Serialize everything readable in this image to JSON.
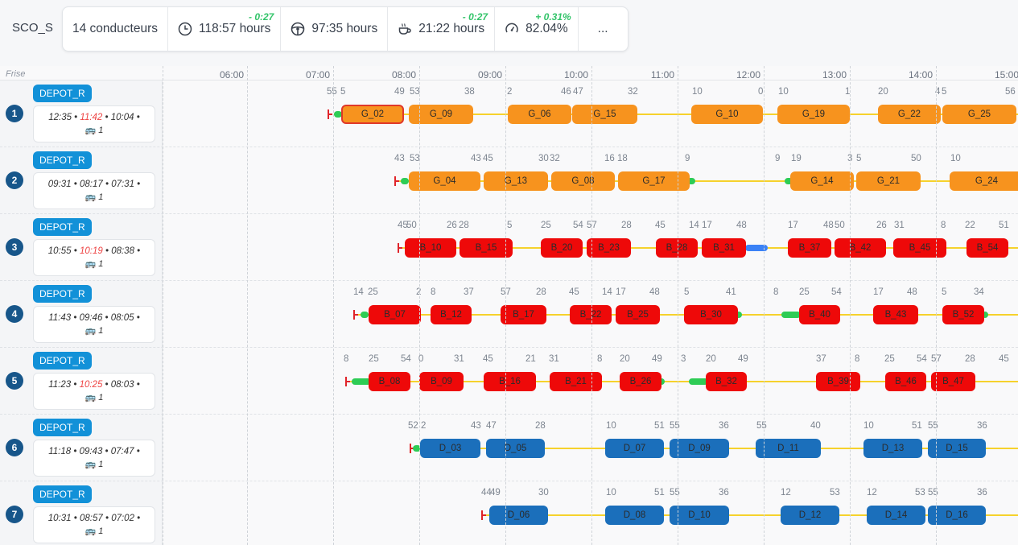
{
  "scenario": "SCO_S",
  "stats": {
    "drivers": "14 conducteurs",
    "total": "118:57 hours",
    "total_delta": "- 0:27",
    "driving": "97:35 hours",
    "pause": "21:22 hours",
    "pause_delta": "- 0:27",
    "ratio": "82.04%",
    "ratio_delta": "+ 0.31%",
    "more": "..."
  },
  "frise_label": "Frise",
  "hours": [
    "06:00",
    "07:00",
    "08:00",
    "09:00",
    "10:00",
    "11:00",
    "12:00",
    "13:00",
    "14:00",
    "15:00"
  ],
  "rows": [
    {
      "num": "1",
      "depot": "DEPOT_R",
      "t1": "12:35",
      "t2": "11:42",
      "t2_late": true,
      "t3": "10:04",
      "buses": "1",
      "marks": [
        "55",
        "5",
        "49",
        "53",
        "38",
        "2",
        "46",
        "47",
        "32",
        "10",
        "0",
        "10",
        "1",
        "20",
        "4",
        "5",
        "56"
      ],
      "blocks": [
        {
          "label": "G_02",
          "color": "orange",
          "selected": true
        },
        {
          "label": "G_09",
          "color": "orange"
        },
        {
          "label": "G_06",
          "color": "orange"
        },
        {
          "label": "G_15",
          "color": "orange"
        },
        {
          "label": "G_10",
          "color": "orange"
        },
        {
          "label": "G_19",
          "color": "orange"
        },
        {
          "label": "G_22",
          "color": "orange"
        },
        {
          "label": "G_25",
          "color": "orange"
        }
      ]
    },
    {
      "num": "2",
      "depot": "DEPOT_R",
      "t1": "09:31",
      "t2": "08:17",
      "t2_late": false,
      "t3": "07:31",
      "buses": "1",
      "marks": [
        "43",
        "53",
        "43",
        "45",
        "30",
        "32",
        "16",
        "18",
        "9",
        "9",
        "19",
        "3",
        "5",
        "50",
        "10"
      ],
      "blocks": [
        {
          "label": "G_04",
          "color": "orange"
        },
        {
          "label": "G_13",
          "color": "orange"
        },
        {
          "label": "G_08",
          "color": "orange"
        },
        {
          "label": "G_17",
          "color": "orange"
        },
        {
          "label": "G_14",
          "color": "orange"
        },
        {
          "label": "G_21",
          "color": "orange"
        },
        {
          "label": "G_24",
          "color": "orange"
        }
      ]
    },
    {
      "num": "3",
      "depot": "DEPOT_R",
      "t1": "10:55",
      "t2": "10:19",
      "t2_late": true,
      "t3": "08:38",
      "buses": "1",
      "marks": [
        "45",
        "50",
        "26",
        "28",
        "5",
        "25",
        "54",
        "57",
        "28",
        "45",
        "14",
        "17",
        "48",
        "17",
        "48",
        "50",
        "26",
        "31",
        "8",
        "22",
        "51"
      ],
      "blocks": [
        {
          "label": "B_10",
          "color": "red"
        },
        {
          "label": "B_15",
          "color": "red"
        },
        {
          "label": "B_20",
          "color": "red"
        },
        {
          "label": "B_23",
          "color": "red"
        },
        {
          "label": "B_28",
          "color": "red"
        },
        {
          "label": "B_31",
          "color": "red"
        },
        {
          "label": "B_37",
          "color": "red"
        },
        {
          "label": "B_42",
          "color": "red"
        },
        {
          "label": "B_45",
          "color": "red"
        },
        {
          "label": "B_54",
          "color": "red"
        }
      ]
    },
    {
      "num": "4",
      "depot": "DEPOT_R",
      "t1": "11:43",
      "t2": "09:46",
      "t2_late": false,
      "t3": "08:05",
      "buses": "1",
      "marks": [
        "14",
        "25",
        "2",
        "8",
        "37",
        "57",
        "28",
        "45",
        "14",
        "17",
        "48",
        "5",
        "41",
        "8",
        "25",
        "54",
        "17",
        "48",
        "5",
        "34"
      ],
      "blocks": [
        {
          "label": "B_07",
          "color": "red"
        },
        {
          "label": "B_12",
          "color": "red"
        },
        {
          "label": "B_17",
          "color": "red"
        },
        {
          "label": "B_22",
          "color": "red"
        },
        {
          "label": "B_25",
          "color": "red"
        },
        {
          "label": "B_30",
          "color": "red"
        },
        {
          "label": "B_40",
          "color": "red"
        },
        {
          "label": "B_43",
          "color": "red"
        },
        {
          "label": "B_52",
          "color": "red"
        }
      ]
    },
    {
      "num": "5",
      "depot": "DEPOT_R",
      "t1": "11:23",
      "t2": "10:25",
      "t2_late": true,
      "t3": "08:03",
      "buses": "1",
      "marks": [
        "8",
        "25",
        "54",
        "0",
        "31",
        "45",
        "21",
        "31",
        "8",
        "20",
        "49",
        "3",
        "20",
        "49",
        "37",
        "8",
        "25",
        "54",
        "57",
        "28",
        "45"
      ],
      "blocks": [
        {
          "label": "B_08",
          "color": "red"
        },
        {
          "label": "B_09",
          "color": "red"
        },
        {
          "label": "B_16",
          "color": "red"
        },
        {
          "label": "B_21",
          "color": "red"
        },
        {
          "label": "B_26",
          "color": "red"
        },
        {
          "label": "B_32",
          "color": "red"
        },
        {
          "label": "B_39",
          "color": "red"
        },
        {
          "label": "B_46",
          "color": "red"
        },
        {
          "label": "B_47",
          "color": "red"
        }
      ]
    },
    {
      "num": "6",
      "depot": "DEPOT_R",
      "t1": "11:18",
      "t2": "09:43",
      "t2_late": false,
      "t3": "07:47",
      "buses": "1",
      "marks": [
        "52",
        "2",
        "43",
        "47",
        "28",
        "10",
        "51",
        "55",
        "36",
        "55",
        "40",
        "10",
        "51",
        "55",
        "36"
      ],
      "blocks": [
        {
          "label": "D_03",
          "color": "blue"
        },
        {
          "label": "D_05",
          "color": "blue"
        },
        {
          "label": "D_07",
          "color": "blue"
        },
        {
          "label": "D_09",
          "color": "blue"
        },
        {
          "label": "D_11",
          "color": "blue"
        },
        {
          "label": "D_13",
          "color": "blue"
        },
        {
          "label": "D_15",
          "color": "blue"
        }
      ]
    },
    {
      "num": "7",
      "depot": "DEPOT_R",
      "t1": "10:31",
      "t2": "08:57",
      "t2_late": false,
      "t3": "07:02",
      "buses": "1",
      "marks": [
        "44",
        "49",
        "30",
        "10",
        "51",
        "55",
        "36",
        "12",
        "53",
        "12",
        "53",
        "55",
        "36"
      ],
      "blocks": [
        {
          "label": "D_06",
          "color": "blue"
        },
        {
          "label": "D_08",
          "color": "blue"
        },
        {
          "label": "D_10",
          "color": "blue"
        },
        {
          "label": "D_12",
          "color": "blue"
        },
        {
          "label": "D_14",
          "color": "blue"
        },
        {
          "label": "D_16",
          "color": "blue"
        }
      ]
    }
  ]
}
